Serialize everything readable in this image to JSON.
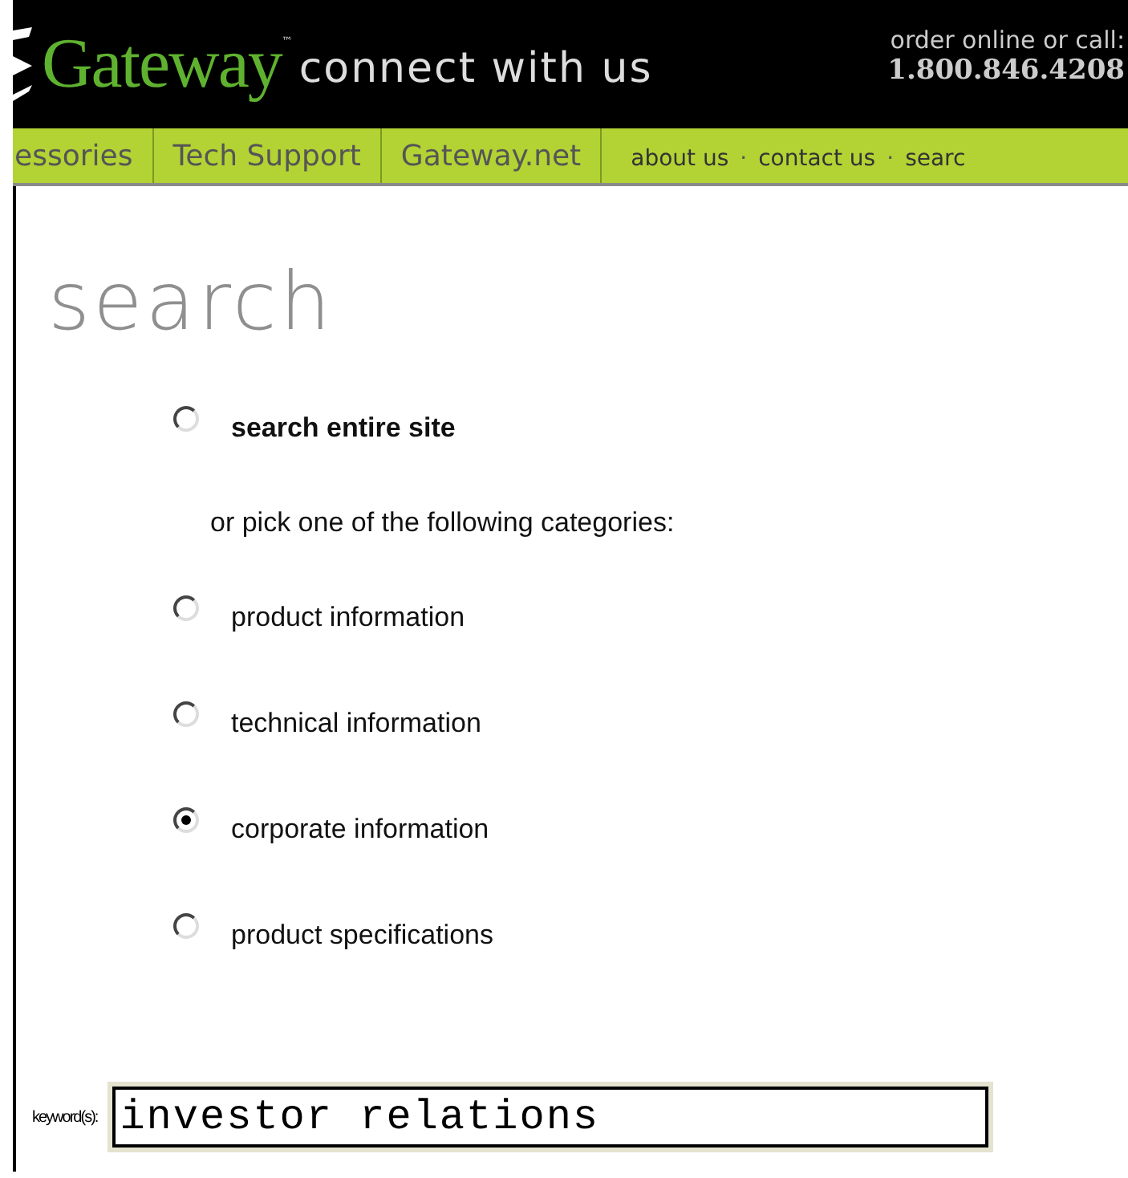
{
  "header": {
    "logo": "Gateway",
    "trademark": "™",
    "tagline": "connect with us",
    "order_label": "order online or call:",
    "phone": "1.800.846.4208"
  },
  "nav": {
    "tabs": [
      "essories",
      "Tech Support",
      "Gateway.net"
    ],
    "links": [
      "about us",
      "contact us",
      "searc"
    ],
    "separator": "·"
  },
  "page_title": "search",
  "scope_option": {
    "label": "search entire site",
    "selected": false
  },
  "note": "or pick one of the following categories:",
  "categories": [
    {
      "label": "product information",
      "selected": false
    },
    {
      "label": "technical information",
      "selected": false
    },
    {
      "label": "corporate information",
      "selected": true
    },
    {
      "label": "product specifications",
      "selected": false
    }
  ],
  "keywords": {
    "label": "keyword(s):",
    "value": "investor relations"
  }
}
